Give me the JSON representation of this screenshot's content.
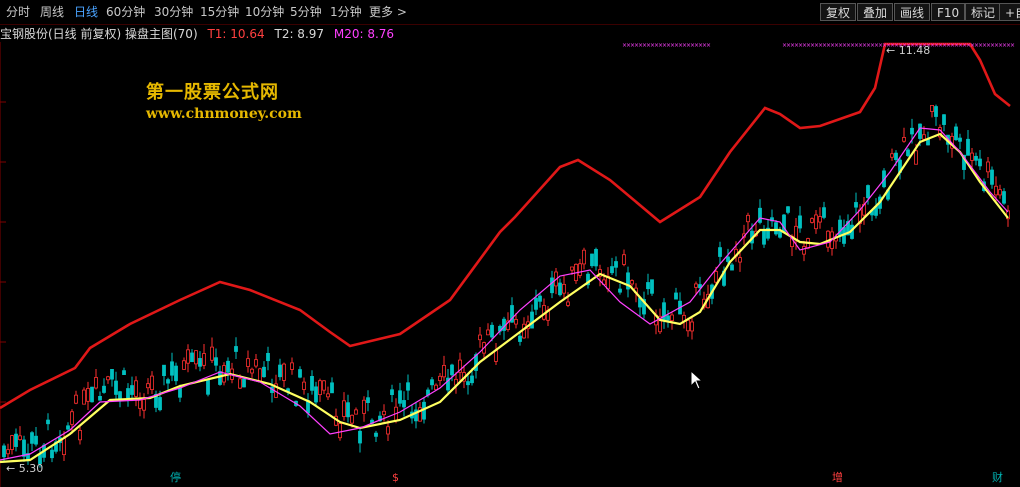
{
  "toolbar": {
    "periods": [
      "分时",
      "周线",
      "日线",
      "60分钟",
      "30分钟",
      "15分钟",
      "10分钟",
      "5分钟",
      "1分钟",
      "更多 >"
    ],
    "active_period": "日线",
    "buttons": [
      "复权",
      "叠加",
      "画线",
      "F10",
      "标记",
      "+自"
    ]
  },
  "info": {
    "title": "宝钢股份(日线 前复权) 操盘主图(70)",
    "t1": "T1: 10.64",
    "t2": "T2: 8.97",
    "m20": "M20: 8.76"
  },
  "watermark": {
    "line1": "第一股票公式网",
    "line2": "www.chnmoney.com"
  },
  "price_labels": {
    "high": "11.48",
    "low": "5.30"
  },
  "markers": [
    {
      "text": "停",
      "color": "#00b0b0"
    },
    {
      "text": "$",
      "color": "#ff4040"
    },
    {
      "text": "增",
      "color": "#ff4040"
    },
    {
      "text": "财",
      "color": "#00b0b0"
    }
  ],
  "colors": {
    "background": "#000000",
    "up_candle": "#ff3030",
    "down_candle": "#00c0c0",
    "upper_band": "#e01818",
    "mid_line": "#ffff60",
    "ma_line": "#ff40ff",
    "active_tab": "#4aa3ff",
    "t1": "#ff4040",
    "m20": "#ff40ff",
    "watermark": "#e6b800"
  },
  "chart_data": {
    "type": "line",
    "series": [
      {
        "name": "T1",
        "last": 10.64
      },
      {
        "name": "T2",
        "last": 8.97
      },
      {
        "name": "M20",
        "last": 8.76
      }
    ],
    "annotations": [
      "11.48",
      "5.30"
    ]
  }
}
